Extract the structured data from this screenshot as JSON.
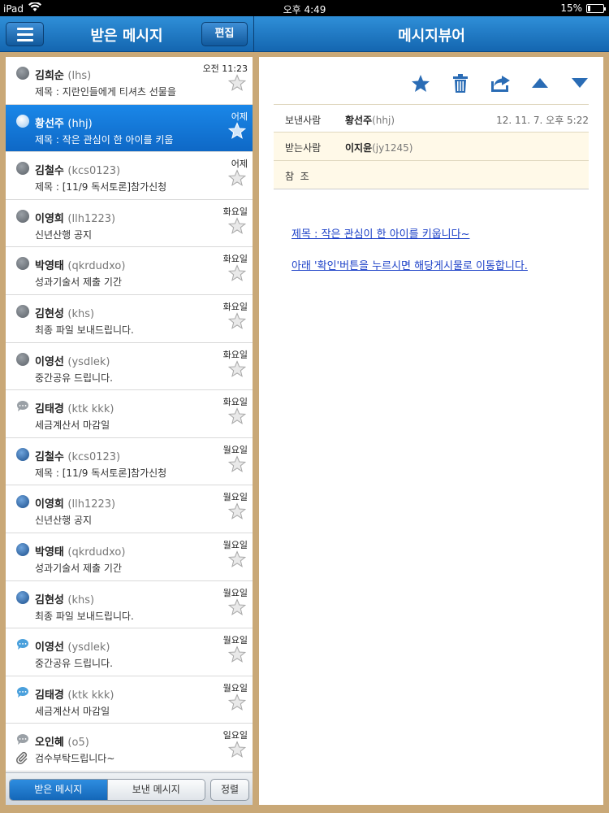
{
  "status_bar": {
    "device": "iPad",
    "time": "오후 4:49",
    "battery": "15%",
    "battery_level": 0.15
  },
  "list_header": {
    "title": "받은 메시지",
    "edit_label": "편집"
  },
  "viewer_header": {
    "title": "메시지뷰어"
  },
  "messages": [
    {
      "name": "김희순",
      "uid": "(lhs)",
      "subject": "제목 : 지란인들에게 티셔츠 선물을",
      "time": "오전 11:23",
      "icon": "globe-gray-icon",
      "selected": false,
      "attachment": false
    },
    {
      "name": "황선주",
      "uid": "(hhj)",
      "subject": "제목 : 작은 관심이 한 아이를 키웁",
      "time": "어제",
      "icon": "globe-gray-icon",
      "selected": true,
      "attachment": false
    },
    {
      "name": "김철수",
      "uid": "(kcs0123)",
      "subject": "제목 : [11/9 독서토론]참가신청",
      "time": "어제",
      "icon": "globe-gray-icon",
      "selected": false,
      "attachment": false
    },
    {
      "name": "이영희",
      "uid": "(llh1223)",
      "subject": "신년산행 공지",
      "time": "화요일",
      "icon": "globe-gray-icon",
      "selected": false,
      "attachment": false
    },
    {
      "name": "박영태",
      "uid": "(qkrdudxo)",
      "subject": "성과기술서 제출 기간",
      "time": "화요일",
      "icon": "globe-gray-icon",
      "selected": false,
      "attachment": false
    },
    {
      "name": "김현성",
      "uid": "(khs)",
      "subject": "최종 파일 보내드립니다.",
      "time": "화요일",
      "icon": "globe-gray-icon",
      "selected": false,
      "attachment": false
    },
    {
      "name": "이영선",
      "uid": "(ysdlek)",
      "subject": "중간공유 드립니다.",
      "time": "화요일",
      "icon": "globe-gray-icon",
      "selected": false,
      "attachment": false
    },
    {
      "name": "김태경",
      "uid": "(ktk kkk)",
      "subject": "세금계산서 마감일",
      "time": "화요일",
      "icon": "chat-gray-icon",
      "selected": false,
      "attachment": false
    },
    {
      "name": "김철수",
      "uid": "(kcs0123)",
      "subject": "제목 : [11/9 독서토론]참가신청",
      "time": "월요일",
      "icon": "globe-blue-icon",
      "selected": false,
      "attachment": false
    },
    {
      "name": "이영희",
      "uid": "(llh1223)",
      "subject": "신년산행 공지",
      "time": "월요일",
      "icon": "globe-blue-icon",
      "selected": false,
      "attachment": false
    },
    {
      "name": "박영태",
      "uid": "(qkrdudxo)",
      "subject": "성과기술서 제출 기간",
      "time": "월요일",
      "icon": "globe-blue-icon",
      "selected": false,
      "attachment": false
    },
    {
      "name": "김현성",
      "uid": "(khs)",
      "subject": "최종 파일 보내드립니다.",
      "time": "월요일",
      "icon": "globe-blue-icon",
      "selected": false,
      "attachment": false
    },
    {
      "name": "이영선",
      "uid": "(ysdlek)",
      "subject": "중간공유 드립니다.",
      "time": "월요일",
      "icon": "chat-blue-icon",
      "selected": false,
      "attachment": false
    },
    {
      "name": "김태경",
      "uid": "(ktk kkk)",
      "subject": "세금계산서 마감일",
      "time": "월요일",
      "icon": "chat-blue-icon",
      "selected": false,
      "attachment": false
    },
    {
      "name": "오인혜",
      "uid": "(o5)",
      "subject": "검수부탁드립니다~",
      "time": "일요일",
      "icon": "chat-gray-icon",
      "selected": false,
      "attachment": true
    }
  ],
  "list_footer": {
    "tab_inbox": "받은 메시지",
    "tab_sent": "보낸 메시지",
    "sort_label": "정렬"
  },
  "viewer": {
    "toolbar_icons": [
      "star-icon",
      "trash-icon",
      "forward-icon",
      "arrow-up-icon",
      "arrow-down-icon"
    ],
    "sender_label": "보낸사람",
    "sender_name": "황선주",
    "sender_uid": "(hhj)",
    "date": "12. 11. 7. 오후 5:22",
    "receiver_label": "받는사람",
    "receiver_name": "이지윤",
    "receiver_uid": "(jy1245)",
    "cc_label": "참  조",
    "body_line1": "제목 : 작은 관심이 한 아이를 키웁니다~",
    "body_line2": "아래 '확인'버튼을 누르시면 해당게시물로 이동합니다."
  },
  "colors": {
    "nav_blue": "#1a78c8",
    "selected_blue": "#1479d8",
    "link_blue": "#1a3fc7",
    "background_wood": "#c9a877"
  }
}
